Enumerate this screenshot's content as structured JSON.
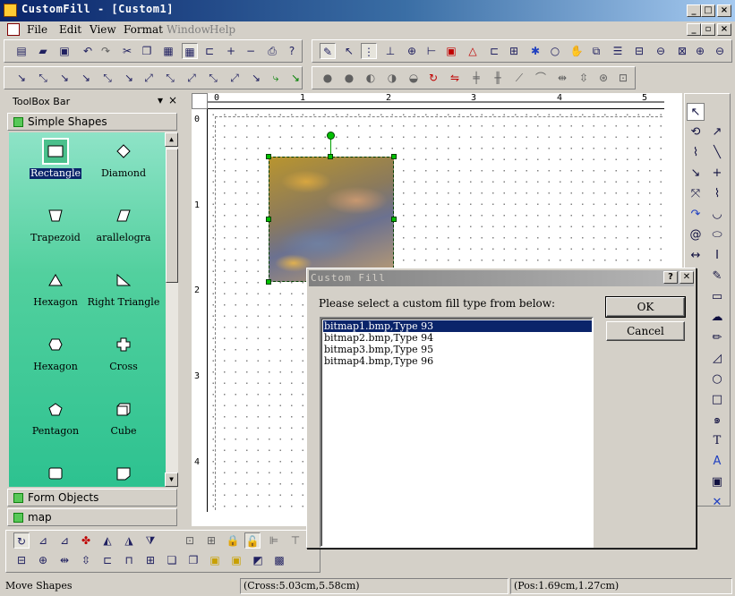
{
  "window": {
    "title": "CustomFill - [Custom1]"
  },
  "menu": [
    "File",
    "Edit",
    "View",
    "Format",
    "Window",
    "Help"
  ],
  "toolbox": {
    "title": "ToolBox Bar",
    "sections": {
      "simple": "Simple Shapes",
      "form": "Form Objects",
      "map": "map"
    },
    "shapes": [
      {
        "label": "Rectangle",
        "icon": "rectangle-icon",
        "glyph": "▭"
      },
      {
        "label": "Diamond",
        "icon": "diamond-icon",
        "glyph": "◇"
      },
      {
        "label": "Trapezoid",
        "icon": "trapezoid-icon",
        "glyph": "⏢"
      },
      {
        "label": "arallelogra",
        "icon": "parallelogram-icon",
        "glyph": "▱"
      },
      {
        "label": "Hexagon",
        "icon": "triangle-icon",
        "glyph": "△"
      },
      {
        "label": "Right Triangle",
        "icon": "right-triangle-icon",
        "glyph": "◺"
      },
      {
        "label": "Hexagon",
        "icon": "hexagon-icon",
        "glyph": "⬡"
      },
      {
        "label": "Cross",
        "icon": "cross-icon",
        "glyph": "✚"
      },
      {
        "label": "Pentagon",
        "icon": "pentagon-icon",
        "glyph": "⬠"
      },
      {
        "label": "Cube",
        "icon": "cube-icon",
        "glyph": "❒"
      },
      {
        "label": "",
        "icon": "rounded-square-icon",
        "glyph": "▢"
      },
      {
        "label": "",
        "icon": "folded-corner-icon",
        "glyph": "◫"
      }
    ]
  },
  "ruler": {
    "h": [
      "0",
      "1",
      "2",
      "3",
      "4",
      "5"
    ],
    "v": [
      "0",
      "1",
      "2",
      "3",
      "4"
    ]
  },
  "dialog": {
    "title": "Custom Fill",
    "prompt": "Please select a custom fill type from below:",
    "items": [
      "bitmap1.bmp,Type 93",
      "bitmap2.bmp,Type 94",
      "bitmap3.bmp,Type 95",
      "bitmap4.bmp,Type 96"
    ],
    "selected_index": 0,
    "ok": "OK",
    "cancel": "Cancel",
    "help": "?",
    "close": "✕"
  },
  "status": {
    "left": "Move Shapes",
    "cross": "(Cross:5.03cm,5.58cm)",
    "pos": "(Pos:1.69cm,1.27cm)"
  },
  "colors": {
    "title_active": "#0a246a",
    "panel_green": "#2dc290",
    "selection": "#0a246a"
  }
}
